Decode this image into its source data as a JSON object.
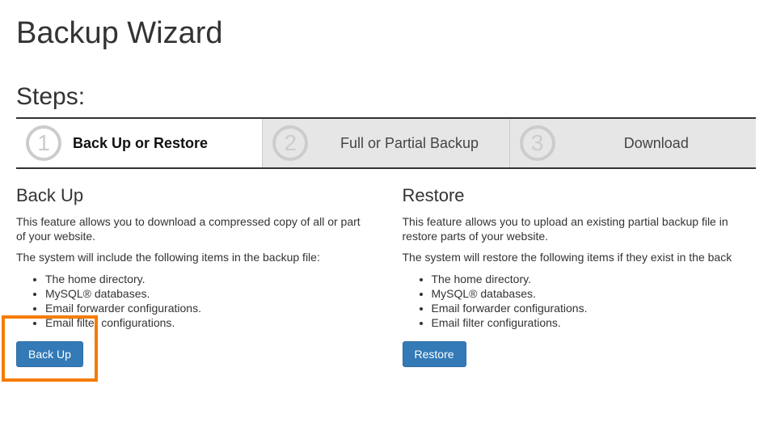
{
  "page": {
    "title": "Backup Wizard",
    "steps_heading": "Steps:"
  },
  "steps": [
    {
      "number": "1",
      "label": "Back Up or Restore"
    },
    {
      "number": "2",
      "label": "Full or Partial Backup"
    },
    {
      "number": "3",
      "label": "Download"
    }
  ],
  "backup": {
    "heading": "Back Up",
    "desc": "This feature allows you to download a compressed copy of all or part of your website.",
    "intro": "The system will include the following items in the backup file:",
    "items": [
      "The home directory.",
      "MySQL® databases.",
      "Email forwarder configurations.",
      "Email filter configurations."
    ],
    "button": "Back Up"
  },
  "restore": {
    "heading": "Restore",
    "desc": "This feature allows you to upload an existing partial backup file in restore parts of your website.",
    "intro": "The system will restore the following items if they exist in the back",
    "items": [
      "The home directory.",
      "MySQL® databases.",
      "Email forwarder configurations.",
      "Email filter configurations."
    ],
    "button": "Restore"
  }
}
